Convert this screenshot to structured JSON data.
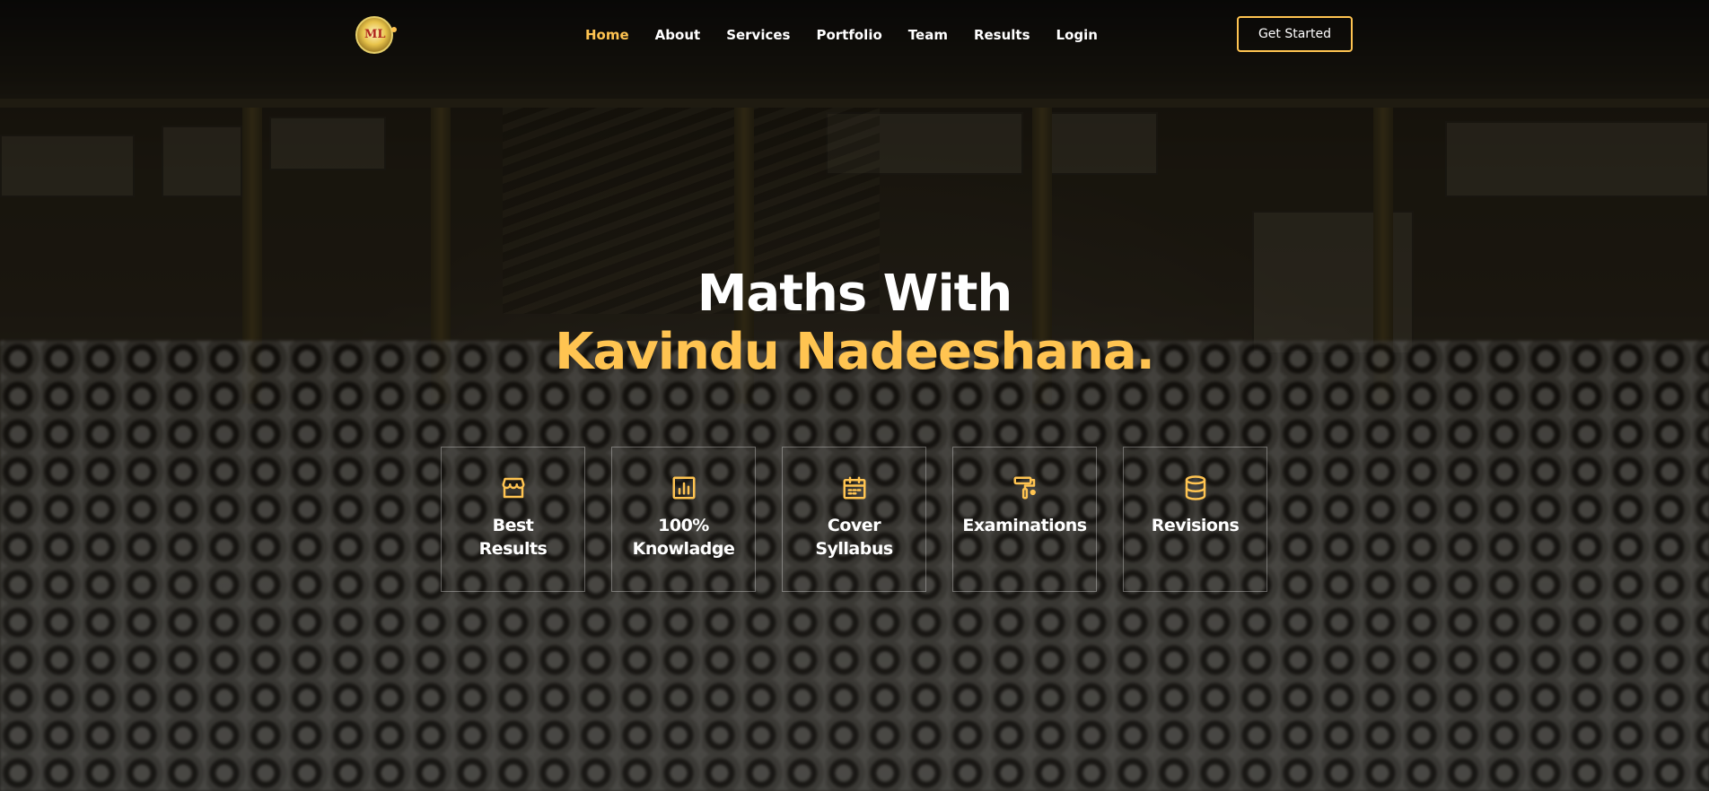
{
  "colors": {
    "accent": "#ffc451",
    "text": "#ffffff",
    "overlay": "rgba(0,0,0,0.58)"
  },
  "header": {
    "logo_text": "ML",
    "nav": [
      {
        "label": "Home",
        "active": true
      },
      {
        "label": "About",
        "active": false
      },
      {
        "label": "Services",
        "active": false
      },
      {
        "label": "Portfolio",
        "active": false
      },
      {
        "label": "Team",
        "active": false
      },
      {
        "label": "Results",
        "active": false
      },
      {
        "label": "Login",
        "active": false
      }
    ],
    "cta_label": "Get Started"
  },
  "hero": {
    "title_line1": "Maths With",
    "title_line2": "Kavindu Nadeeshana."
  },
  "features": [
    {
      "icon": "store-icon",
      "label": "Best\nResults"
    },
    {
      "icon": "bar-chart-icon",
      "label": "100%\nKnowladge"
    },
    {
      "icon": "calendar-icon",
      "label": "Cover\nSyllabus"
    },
    {
      "icon": "paint-roller-icon",
      "label": "Examinations"
    },
    {
      "icon": "database-icon",
      "label": "Revisions"
    }
  ]
}
